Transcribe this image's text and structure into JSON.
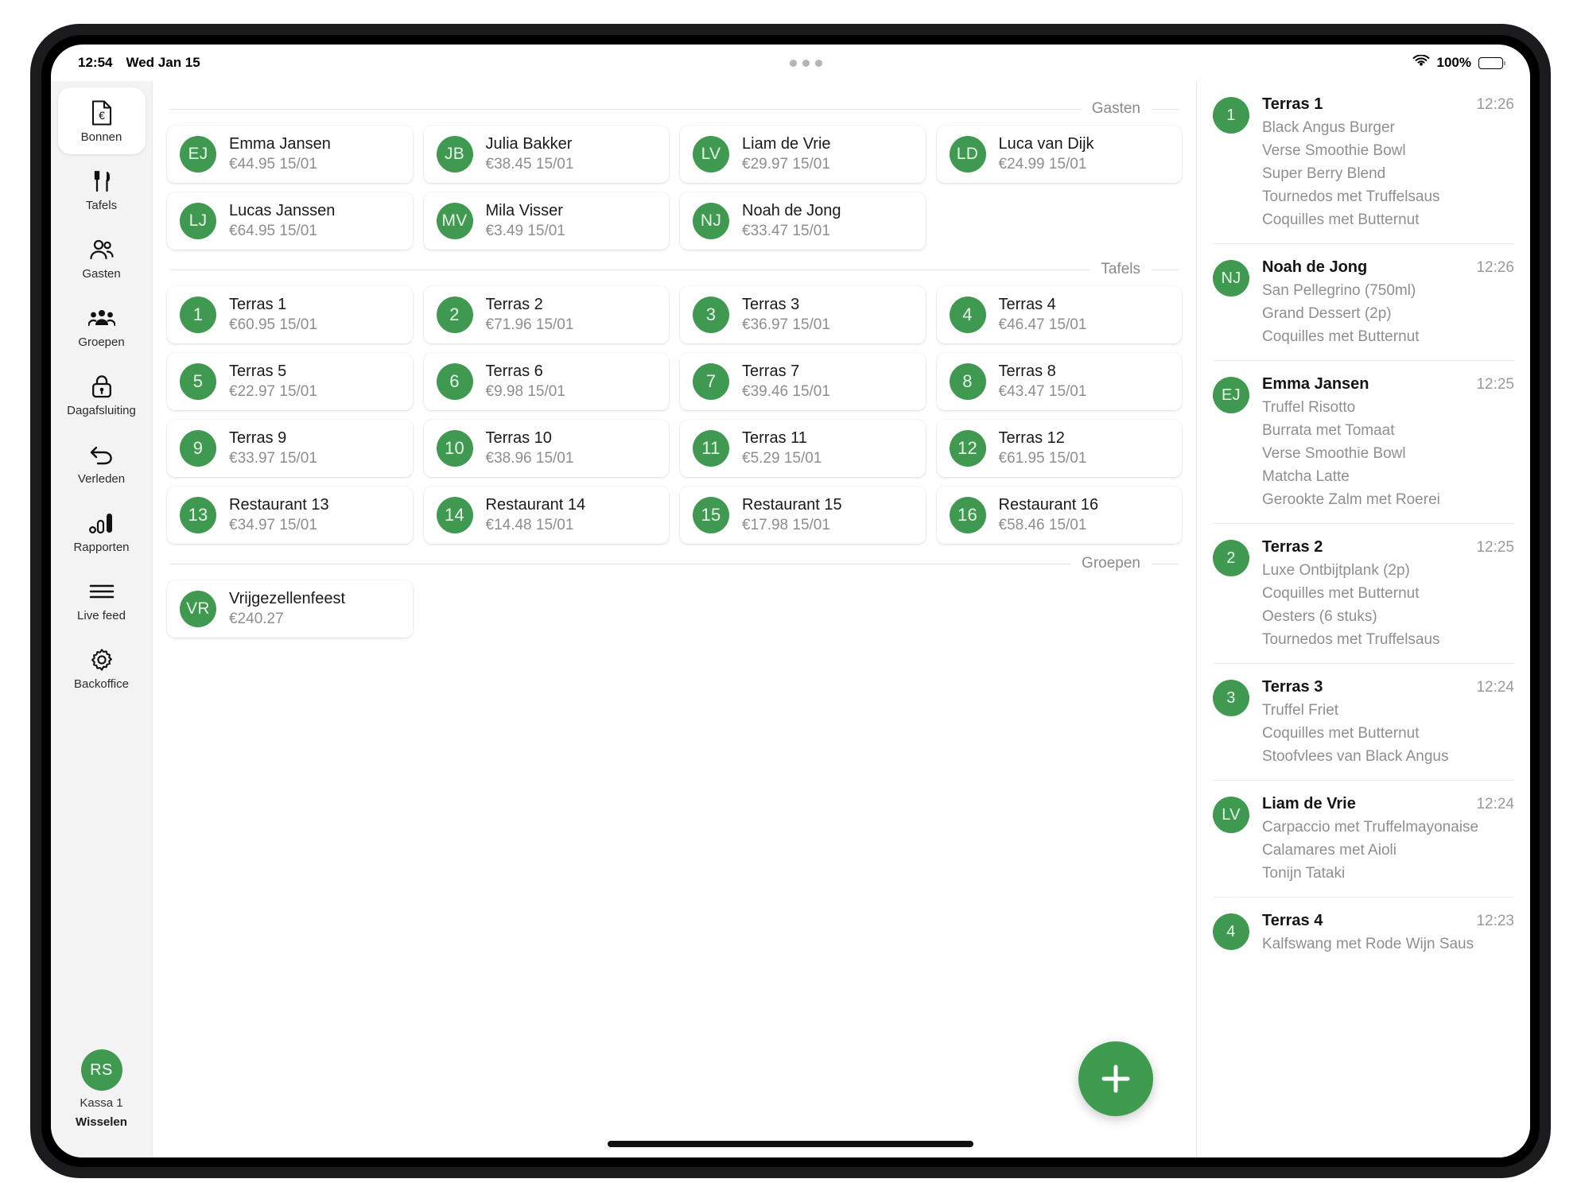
{
  "statusbar": {
    "time": "12:54",
    "date": "Wed Jan 15",
    "battery_percent": "100%",
    "wifi_icon": "wifi-icon",
    "battery_icon": "battery-icon"
  },
  "sidebar": {
    "items": [
      {
        "label": "Bonnen",
        "icon": "receipt-euro-icon",
        "active": true
      },
      {
        "label": "Tafels",
        "icon": "cutlery-icon",
        "active": false
      },
      {
        "label": "Gasten",
        "icon": "people-icon",
        "active": false
      },
      {
        "label": "Groepen",
        "icon": "group-icon",
        "active": false
      },
      {
        "label": "Dagafsluiting",
        "icon": "lock-icon",
        "active": false
      },
      {
        "label": "Verleden",
        "icon": "undo-arrow-icon",
        "active": false
      },
      {
        "label": "Rapporten",
        "icon": "bar-chart-icon",
        "active": false
      },
      {
        "label": "Live feed",
        "icon": "list-lines-icon",
        "active": false
      },
      {
        "label": "Backoffice",
        "icon": "gear-icon",
        "active": false
      }
    ],
    "user": {
      "initials": "RS",
      "name": "Kassa 1",
      "switch_label": "Wisselen"
    }
  },
  "main": {
    "fab_label": "+",
    "sections": [
      {
        "title": "Gasten",
        "cards": [
          {
            "badge": "EJ",
            "badge_type": "initials",
            "title": "Emma Jansen",
            "sub": "€44.95 15/01"
          },
          {
            "badge": "JB",
            "badge_type": "initials",
            "title": "Julia Bakker",
            "sub": "€38.45 15/01"
          },
          {
            "badge": "LV",
            "badge_type": "initials",
            "title": "Liam de Vrie",
            "sub": "€29.97 15/01"
          },
          {
            "badge": "LD",
            "badge_type": "initials",
            "title": "Luca van Dijk",
            "sub": "€24.99 15/01"
          },
          {
            "badge": "LJ",
            "badge_type": "initials",
            "title": "Lucas Janssen",
            "sub": "€64.95 15/01"
          },
          {
            "badge": "MV",
            "badge_type": "initials",
            "title": "Mila Visser",
            "sub": "€3.49 15/01"
          },
          {
            "badge": "NJ",
            "badge_type": "initials",
            "title": "Noah de Jong",
            "sub": "€33.47 15/01"
          }
        ]
      },
      {
        "title": "Tafels",
        "cards": [
          {
            "badge": "1",
            "badge_type": "number",
            "title": "Terras 1",
            "sub": "€60.95 15/01"
          },
          {
            "badge": "2",
            "badge_type": "number",
            "title": "Terras 2",
            "sub": "€71.96 15/01"
          },
          {
            "badge": "3",
            "badge_type": "number",
            "title": "Terras 3",
            "sub": "€36.97 15/01"
          },
          {
            "badge": "4",
            "badge_type": "number",
            "title": "Terras 4",
            "sub": "€46.47 15/01"
          },
          {
            "badge": "5",
            "badge_type": "number",
            "title": "Terras 5",
            "sub": "€22.97 15/01"
          },
          {
            "badge": "6",
            "badge_type": "number",
            "title": "Terras 6",
            "sub": "€9.98 15/01"
          },
          {
            "badge": "7",
            "badge_type": "number",
            "title": "Terras 7",
            "sub": "€39.46 15/01"
          },
          {
            "badge": "8",
            "badge_type": "number",
            "title": "Terras 8",
            "sub": "€43.47 15/01"
          },
          {
            "badge": "9",
            "badge_type": "number",
            "title": "Terras 9",
            "sub": "€33.97 15/01"
          },
          {
            "badge": "10",
            "badge_type": "number",
            "title": "Terras 10",
            "sub": "€38.96 15/01"
          },
          {
            "badge": "11",
            "badge_type": "number",
            "title": "Terras 11",
            "sub": "€5.29 15/01"
          },
          {
            "badge": "12",
            "badge_type": "number",
            "title": "Terras 12",
            "sub": "€61.95 15/01"
          },
          {
            "badge": "13",
            "badge_type": "number",
            "title": "Restaurant 13",
            "sub": "€34.97 15/01"
          },
          {
            "badge": "14",
            "badge_type": "number",
            "title": "Restaurant 14",
            "sub": "€14.48 15/01"
          },
          {
            "badge": "15",
            "badge_type": "number",
            "title": "Restaurant 15",
            "sub": "€17.98 15/01"
          },
          {
            "badge": "16",
            "badge_type": "number",
            "title": "Restaurant 16",
            "sub": "€58.46 15/01"
          }
        ]
      },
      {
        "title": "Groepen",
        "cards": [
          {
            "badge": "VR",
            "badge_type": "initials",
            "title": "Vrijgezellenfeest",
            "sub": "€240.27"
          }
        ]
      }
    ]
  },
  "feed": {
    "items": [
      {
        "badge": "1",
        "badge_type": "number",
        "title": "Terras 1",
        "time": "12:26",
        "lines": [
          "Black Angus Burger",
          "Verse Smoothie Bowl",
          "Super Berry Blend",
          "Tournedos met Truffelsaus",
          "Coquilles met Butternut"
        ]
      },
      {
        "badge": "NJ",
        "badge_type": "initials",
        "title": "Noah de Jong",
        "time": "12:26",
        "lines": [
          "San Pellegrino (750ml)",
          "Grand Dessert (2p)",
          "Coquilles met Butternut"
        ]
      },
      {
        "badge": "EJ",
        "badge_type": "initials",
        "title": "Emma Jansen",
        "time": "12:25",
        "lines": [
          "Truffel Risotto",
          "Burrata met Tomaat",
          "Verse Smoothie Bowl",
          "Matcha Latte",
          "Gerookte Zalm met Roerei"
        ]
      },
      {
        "badge": "2",
        "badge_type": "number",
        "title": "Terras 2",
        "time": "12:25",
        "lines": [
          "Luxe Ontbijtplank (2p)",
          "Coquilles met Butternut",
          "Oesters (6 stuks)",
          "Tournedos met Truffelsaus"
        ]
      },
      {
        "badge": "3",
        "badge_type": "number",
        "title": "Terras 3",
        "time": "12:24",
        "lines": [
          "Truffel Friet",
          "Coquilles met Butternut",
          "Stoofvlees van Black Angus"
        ]
      },
      {
        "badge": "LV",
        "badge_type": "initials",
        "title": "Liam de Vrie",
        "time": "12:24",
        "lines": [
          "Carpaccio met Truffelmayonaise",
          "Calamares met Aioli",
          "Tonijn Tataki"
        ]
      },
      {
        "badge": "4",
        "badge_type": "number",
        "title": "Terras 4",
        "time": "12:23",
        "lines": [
          "Kalfswang met Rode Wijn Saus"
        ]
      }
    ]
  },
  "colors": {
    "brand_green": "#409950",
    "sidebar_bg": "#f3f3f3",
    "muted_text": "#8e8e8e"
  }
}
